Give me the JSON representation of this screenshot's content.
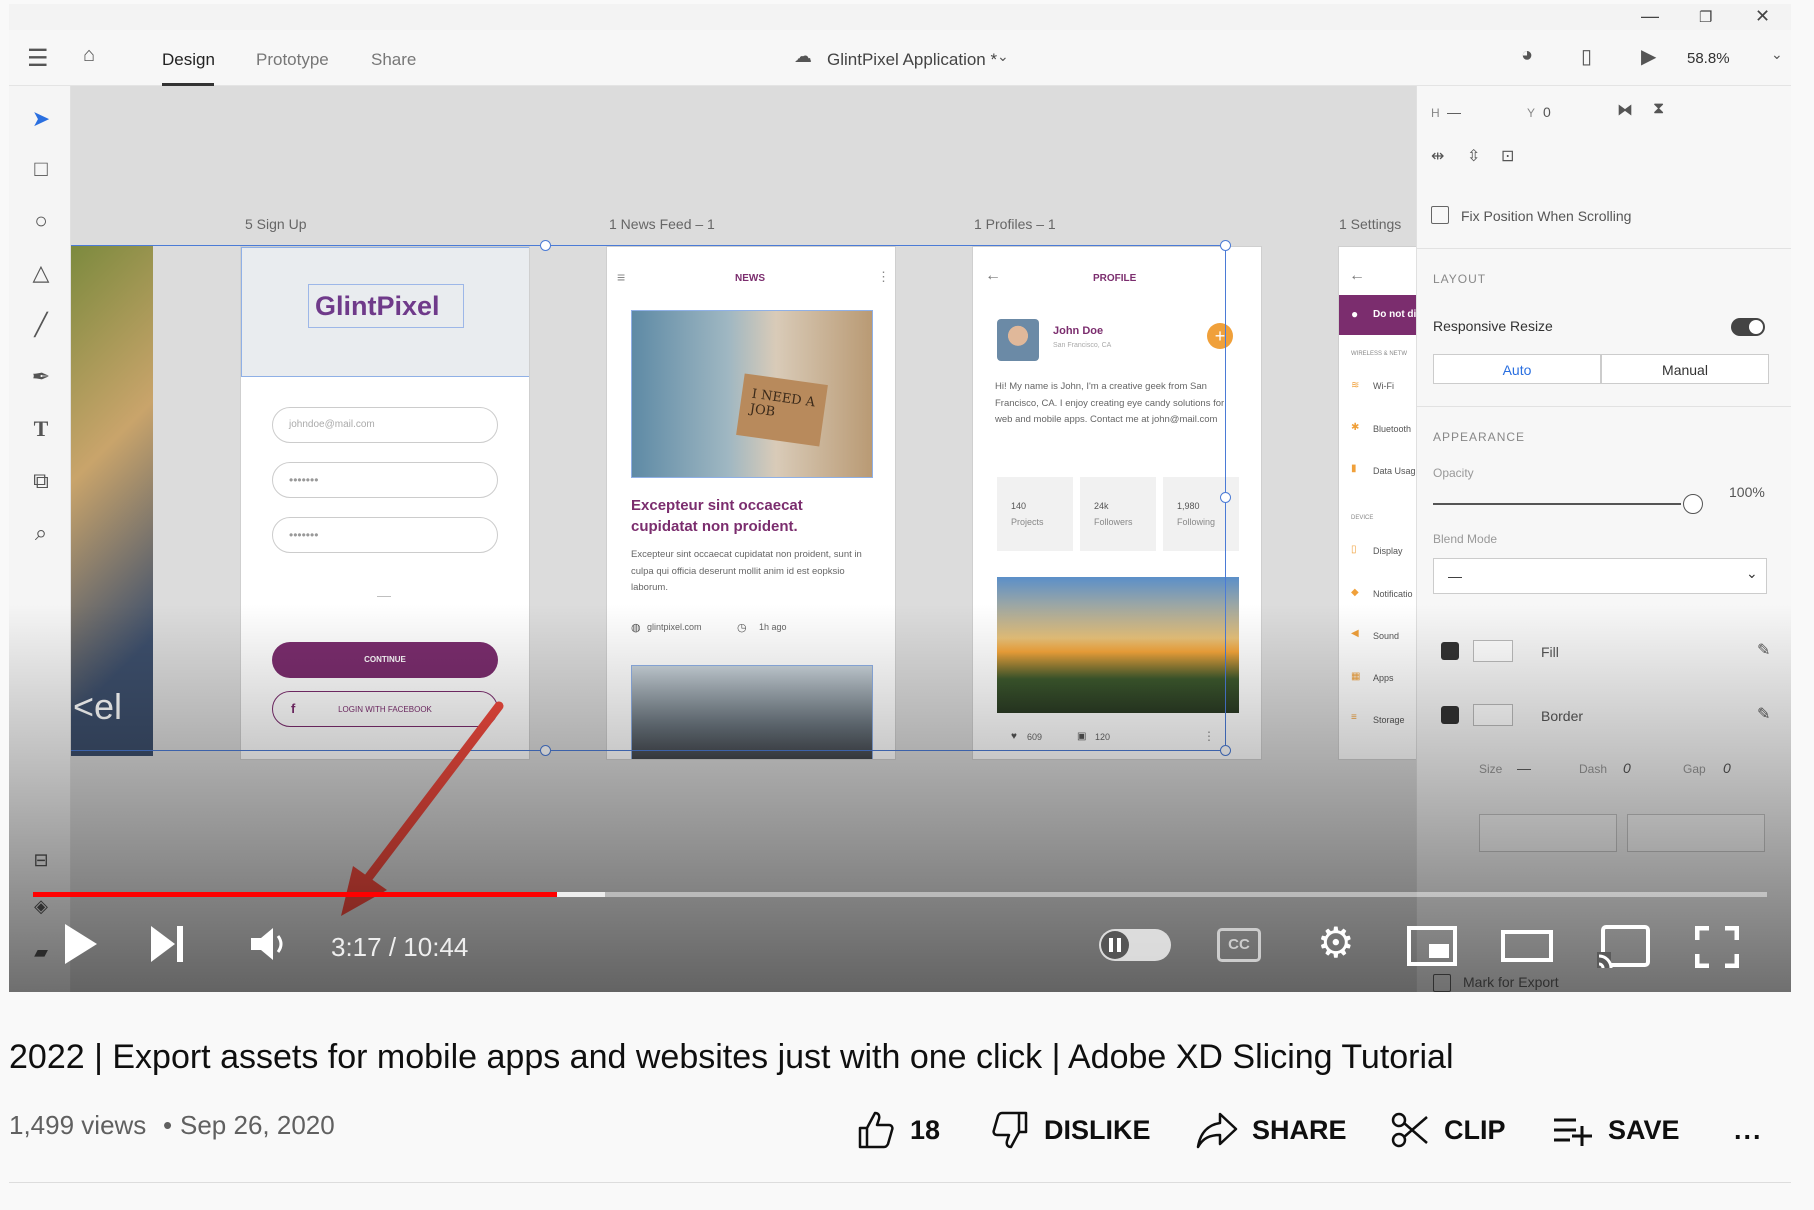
{
  "app": {
    "tabs": [
      "Design",
      "Prototype",
      "Share"
    ],
    "doc_title": "GlintPixel Application *",
    "zoom": "58.8%"
  },
  "artboards": {
    "signup_label": "5 Sign Up",
    "news_label": "1 News Feed – 1",
    "profile_label": "1 Profiles – 1",
    "settings_label": "1 Settings"
  },
  "signup": {
    "logo": "GlintPixel",
    "email_placeholder": "johndoe@mail.com",
    "pw1": "•••••••",
    "pw2": "•••••••",
    "dash": "—",
    "continue": "CONTINUE",
    "facebook": "LOGIN WITH FACEBOOK",
    "fb_icon": "f",
    "side_text": "<el"
  },
  "news": {
    "header": "NEWS",
    "sign_text": "I NEED A JOB",
    "headline": "Excepteur sint occaecat cupidatat non proident.",
    "body": "Excepteur sint occaecat cupidatat non proident, sunt in culpa qui officia deserunt mollit anim id est eopksio laborum.",
    "site": "glintpixel.com",
    "time": "1h ago"
  },
  "profile": {
    "header": "PROFILE",
    "name": "John Doe",
    "location": "San Francisco, CA",
    "bio": "Hi! My name is John, I'm a creative geek from San Francisco, CA. I enjoy creating eye candy solutions for web and mobile apps. Contact me at john@mail.com",
    "stats": [
      {
        "value": "140",
        "label": "Projects"
      },
      {
        "value": "24k",
        "label": "Followers"
      },
      {
        "value": "1,980",
        "label": "Following"
      }
    ],
    "likes": "609",
    "comments": "120",
    "add_icon": "+"
  },
  "settings": {
    "donot": "Do not di",
    "section1": "WIRELESS & NETW",
    "items1": [
      "Wi-Fi",
      "Bluetooth",
      "Data Usag"
    ],
    "section2": "DEVICE",
    "items2": [
      "Display",
      "Notificatio",
      "Sound",
      "Apps",
      "Storage"
    ]
  },
  "panel": {
    "h_label": "H",
    "h_value": "—",
    "y_label": "Y",
    "y_value": "0",
    "fix_position": "Fix Position When Scrolling",
    "layout_heading": "LAYOUT",
    "responsive_resize": "Responsive Resize",
    "seg_auto": "Auto",
    "seg_manual": "Manual",
    "appearance_heading": "APPEARANCE",
    "opacity_label": "Opacity",
    "opacity_value": "100%",
    "blend_label": "Blend Mode",
    "blend_value": "—",
    "fill_label": "Fill",
    "border_label": "Border",
    "size_label": "Size",
    "size_value": "—",
    "dash_label": "Dash",
    "dash_value": "0",
    "gap_label": "Gap",
    "gap_value": "0",
    "mark_export": "Mark for Export"
  },
  "player": {
    "time": "3:17 / 10:44",
    "progress_fraction": 0.302,
    "buffered_fraction": 0.33
  },
  "video": {
    "title": "2022 | Export assets for mobile apps and websites just with one click | Adobe XD Slicing Tutorial",
    "views": "1,499 views",
    "date": "Sep 26, 2020",
    "likes": "18",
    "dislike": "DISLIKE",
    "share": "SHARE",
    "clip": "CLIP",
    "save": "SAVE",
    "more": "..."
  }
}
